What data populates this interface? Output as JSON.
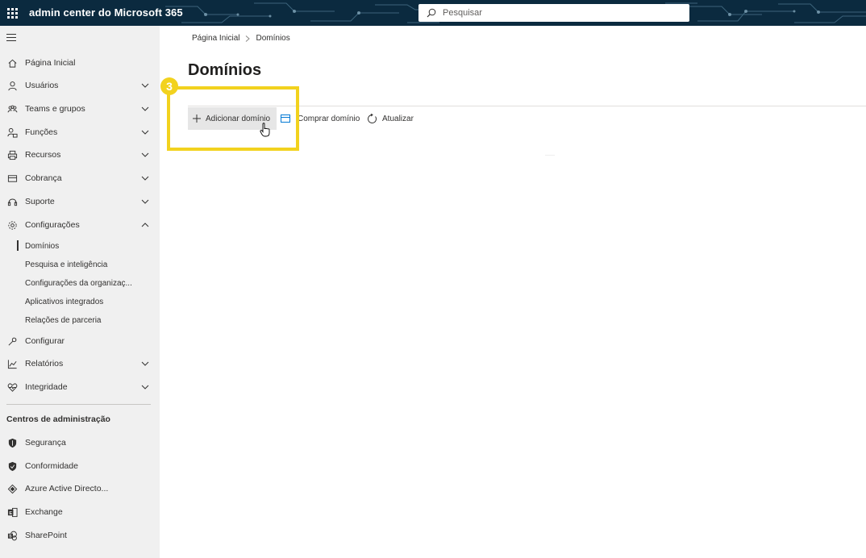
{
  "header": {
    "app_title": "admin center do Microsoft 365",
    "search_placeholder": "Pesquisar",
    "bar_color": "#0b2a3f"
  },
  "sidebar": {
    "items": [
      {
        "label": "Página Inicial",
        "icon": "home-icon",
        "expandable": false
      },
      {
        "label": "Usuários",
        "icon": "person-icon",
        "expandable": true
      },
      {
        "label": "Teams e grupos",
        "icon": "people-icon",
        "expandable": true
      },
      {
        "label": "Funções",
        "icon": "role-icon",
        "expandable": true
      },
      {
        "label": "Recursos",
        "icon": "printer-icon",
        "expandable": true
      },
      {
        "label": "Cobrança",
        "icon": "card-icon",
        "expandable": true
      },
      {
        "label": "Suporte",
        "icon": "headset-icon",
        "expandable": true
      },
      {
        "label": "Configurações",
        "icon": "gear-icon",
        "expandable": true,
        "expanded": true
      }
    ],
    "settings_subitems": [
      {
        "label": "Domínios",
        "selected": true
      },
      {
        "label": "Pesquisa e inteligência"
      },
      {
        "label": "Configurações da organizaç..."
      },
      {
        "label": "Aplicativos integrados"
      },
      {
        "label": "Relações de parceria"
      }
    ],
    "items_after": [
      {
        "label": "Configurar",
        "icon": "wrench-icon",
        "expandable": false
      },
      {
        "label": "Relatórios",
        "icon": "chart-icon",
        "expandable": true
      },
      {
        "label": "Integridade",
        "icon": "heart-icon",
        "expandable": true
      }
    ],
    "admin_centers_header": "Centros de administração",
    "admin_centers": [
      {
        "label": "Segurança",
        "icon": "shield-icon"
      },
      {
        "label": "Conformidade",
        "icon": "shield-icon"
      },
      {
        "label": "Azure Active Directo...",
        "icon": "azure-icon"
      },
      {
        "label": "Exchange",
        "icon": "exchange-icon"
      },
      {
        "label": "SharePoint",
        "icon": "sharepoint-icon"
      }
    ]
  },
  "main": {
    "breadcrumb": [
      "Página Inicial",
      "Domínios"
    ],
    "title": "Domínios",
    "commands": {
      "add_domain": "Adicionar domínio",
      "buy_domain": "Comprar domínio",
      "refresh": "Atualizar"
    }
  },
  "annotation": {
    "step_number": "3",
    "color": "#f2d21e"
  }
}
